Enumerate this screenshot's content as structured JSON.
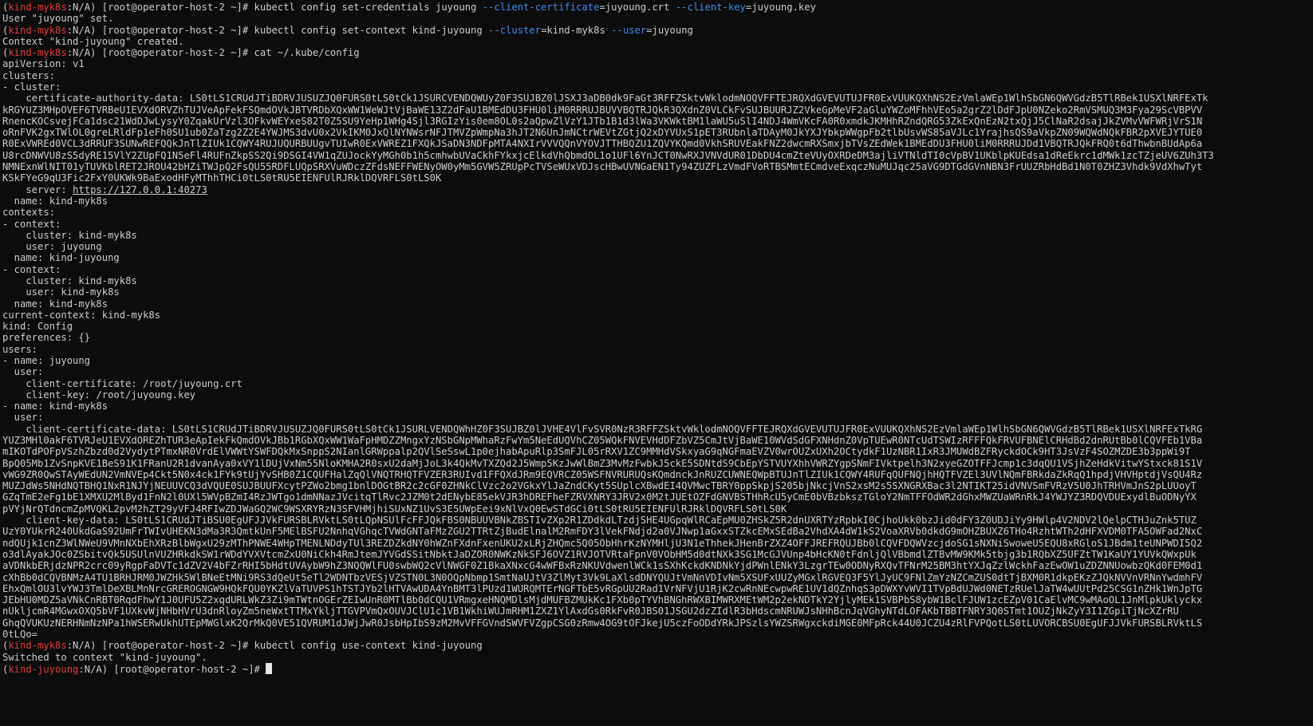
{
  "terminal": {
    "colors": {
      "background": "#0c0c0c",
      "foreground": "#cccccc",
      "prompt_context": "#e23a3a",
      "option_flag": "#3b8eea"
    },
    "lines": [
      [
        {
          "t": "("
        },
        {
          "t": "kind-myk8s",
          "c": "ctx"
        },
        {
          "t": ":N/A) [root@operator-host-2 ~]# kubectl config set-credentials juyoung "
        },
        {
          "t": "--client-certificate",
          "c": "opt"
        },
        {
          "t": "=juyoung.crt "
        },
        {
          "t": "--client-key",
          "c": "opt"
        },
        {
          "t": "=juyoung.key"
        }
      ],
      [
        {
          "t": "User \"juyoung\" set."
        }
      ],
      [
        {
          "t": "("
        },
        {
          "t": "kind-myk8s",
          "c": "ctx"
        },
        {
          "t": ":N/A) [root@operator-host-2 ~]# kubectl config set-context kind-juyoung "
        },
        {
          "t": "--cluster",
          "c": "opt"
        },
        {
          "t": "=kind-myk8s "
        },
        {
          "t": "--user",
          "c": "opt"
        },
        {
          "t": "=juyoung"
        }
      ],
      [
        {
          "t": "Context \"kind-juyoung\" created."
        }
      ],
      [
        {
          "t": "("
        },
        {
          "t": "kind-myk8s",
          "c": "ctx"
        },
        {
          "t": ":N/A) [root@operator-host-2 ~]# cat ~/.kube/config"
        }
      ],
      [
        {
          "t": "apiVersion: v1"
        }
      ],
      [
        {
          "t": "clusters:"
        }
      ],
      [
        {
          "t": "- cluster:"
        }
      ],
      [
        {
          "t": "    certificate-authority-data: LS0tLS1CRUdJTiBDRVJUSUZJQ0FURS0tLS0tCk1JSURCVENDQWUyZ0F3SUJBZ0lJSXJ3aDB0dk9FaGt3RFFZSktvWklodmNOQVFFTEJRQXdGVEVUTUJFR0ExVUUKQXhNS2EzVmlaWEp1WlhSbGN6QWVGdzB5TlRBek1USXlNRFExTk"
        }
      ],
      [
        {
          "t": "kRGYUZ3MHpOVEF6TVRBeU1EVXdORVZhTUJVeApFekFSQmdOVkJBTVRDbXQxWW1WeWJtVjBaWE13Z2dFaU1BMEdDU3FHU0liM0RRRUJBUVVBQTRJQkR3QXdnZ0VLCkFvSUJBUURJZ2VkeGpMeVF2aGluYWZoMFhhVEo5a2grZ2lDdFJpU0NZeko2RmVSMUQ3M3Fya29ScVBPVV"
        }
      ],
      [
        {
          "t": "RnencKOCsvejFCa1dsc21WdDJwLysyY0ZqakUrVzl3OFkvWEYxeS82T0Z5SU9YeHp1WHg4Sjl3RGIzYis0em8OL0s2aQpwZlVzY1JTb1B1d3lWa3VKWktBM1laWU5uSlI4NDJ4WmVKcFA0R0xmdkJKMHhRZndQRG53ZkExQnEzN2txQjJ5ClNaR2dsajJkZVMvVWFWRjVrS1N"
        }
      ],
      [
        {
          "t": "oRnFVK2gxTWlOL0greLRldFp1eFh0SU1ub0ZaTzg2Z2E4YWJMS3dvU0x2VkIKM0JxQlNYNWsrNFJTMVZpWmpNa3hJT2N6UnJmNCtrWEVtZGtjQ2xDYVUxS1pET3RUbnlaTDAyM0JkYXJYbkpWWgpFb2tlbUsvWS85aVJLc1YrajhsQS9aVkpZN09WQWdNQkFBR2pXVEJYTUE0"
        }
      ],
      [
        {
          "t": "R0ExVWREd0VCL3dRRUF3SUNwREFQQkJnTlZIUk1CQWY4RUJUQURBUUgvTUIwR0ExVWREZ1FXQkJSaDN3NDFpMTA4NXIrVVVQQnVYOVJTTHBQZU1ZQVYKQmd0VkhSRUVEakFNZ2dwcmRXSmxjbTVsZEdWek1BMEdDU3FHU0liM0RRRUJDd1VBQTRJQkFRQ0t6dThwbnBUdAp6a"
        }
      ],
      [
        {
          "t": "U8rcDNWVU8zS5dyRE15VlY2ZUpFQ1N5eFl4RUFnZkpSS2Qi9DSGI4VW1qZUJockYyMGh0b1h5cmhwbUVaCkhFYkxjcElkdVhQbmdOL1o1UFl6YnJCT0NwRXJVNVdUR01DbDU4cmZteVUyOXRDeDM3ajliVTNldTI0cVpBV1UKblpKUEdsa1dReEkrc1dMWk1zcTZjeUV6ZUh3T3"
        }
      ],
      [
        {
          "t": "NMNExnWlNIT01yTUVKblRET2JROU42bHZiTWJpQ2FsQU55RDFLUQpSRXVuWDczZFdsNEFFWENyOW0yMm5GVW5ZRUpPcTVSeWUxVDJscHBwUVNGaEN1Ty94ZUZFLzVmdFVoRTBSMmtECmdveExqczNuMUJqc25aVG9DTGdGVnNBN3FrUUZRbHdBd1N0T0ZHZ3Vhdk9VdXhwTyt"
        }
      ],
      [
        {
          "t": "KSkFYeG9qU3Fic2FxY0UKWk9BaExodHFyMThhTHCi0tLS0tRU5EIENFUlRJRklDQVRFLS0tLS0K"
        }
      ],
      [
        {
          "t": "    server: "
        },
        {
          "t": "https://127.0.0.1:40273",
          "c": "url"
        }
      ],
      [
        {
          "t": "  name: kind-myk8s"
        }
      ],
      [
        {
          "t": "contexts:"
        }
      ],
      [
        {
          "t": "- context:"
        }
      ],
      [
        {
          "t": "    cluster: kind-myk8s"
        }
      ],
      [
        {
          "t": "    user: juyoung"
        }
      ],
      [
        {
          "t": "  name: kind-juyoung"
        }
      ],
      [
        {
          "t": "- context:"
        }
      ],
      [
        {
          "t": "    cluster: kind-myk8s"
        }
      ],
      [
        {
          "t": "    user: kind-myk8s"
        }
      ],
      [
        {
          "t": "  name: kind-myk8s"
        }
      ],
      [
        {
          "t": "current-context: kind-myk8s"
        }
      ],
      [
        {
          "t": "kind: Config"
        }
      ],
      [
        {
          "t": "preferences: {}"
        }
      ],
      [
        {
          "t": "users:"
        }
      ],
      [
        {
          "t": "- name: juyoung"
        }
      ],
      [
        {
          "t": "  user:"
        }
      ],
      [
        {
          "t": "    client-certificate: /root/juyoung.crt"
        }
      ],
      [
        {
          "t": "    client-key: /root/juyoung.key"
        }
      ],
      [
        {
          "t": "- name: kind-myk8s"
        }
      ],
      [
        {
          "t": "  user:"
        }
      ],
      [
        {
          "t": "    client-certificate-data: LS0tLS1CRUdJTiBDRVJUSUZJQ0FURS0tLS0tCk1JSURLVENDQWhHZ0F3SUJBZ0lJVHE4VlFvSVR0NzR3RFFZSktvWklodmNOQVFFTEJRQXdGVEVUTUJFR0ExVUUKQXhNS2EzVmlaWEp1WlhSbGN6QWVGdzB5TlRBek1USXlNRFExTkRG"
        }
      ],
      [
        {
          "t": "YUZ3MHl0akF6TVRJeU1EVXdOREZhTUR3eApIekFkQmdOVkJBb1RGbXQxWW1WaFpHMDZZMngxYzNSbGNpMWhaRzFwYm5NeEdUQVhCZ05WQkFNVEVHdDFZbVZ5CmJtVjBaWE10WVdSdGFXNHdnZ0VpTUEwR0NTcUdTSWIzRFFFQkFRVUFBNElCRHdBd2dnRUtBb0lCQVFEb1VBa"
        }
      ],
      [
        {
          "t": "mIKOTdPOFpVSzhZbzd0d2VydytPTmxNR0VrdElVWWtYSWFDQkMxSnppS2NIanlGRWppalp2QVlSeSswL1p0ejhabApuRlp3SmFJL05rRXV1ZC9MMHdVSkxyaG9qNGFmaEVZV0wrOUZxUXh2OCtydkF1UzNBR1IxR3JMUWdBZFRyckdOCk9HT3JsVzF4SOZMZDE3b3ppWi9T"
        }
      ],
      [
        {
          "t": "BpQ05Mb1ZvSnpKVE1BeS91K1FRanU2R1dvanAya0xVY1lDUjVxNm55NloKMHA2R0sxU2daMjJoL3k4QkMvTXZQd2J5Wmp5KzJwWlBmZ3MvMzFwbkJ5ckE5SDNtdS9CbEpYSTVUYXhhVWRZYgpSNmFIVktpelh3N2xyeGZOTFFJcmp1c3dqQU1VSjhZeHdkVitwYStxck81S1V"
        }
      ],
      [
        {
          "t": "vWG9ZR0QwSTAyWEdUN2VmNVEp4Ckt5N0x4ck1FYk9tUjYvSHB0Z1CQUFHalZqQlVNQTRHQTFVZER3RUIvd1FFQXdJRm9EQVRCZ05WSFNVRURUQsKQmdnckJnRUZCUWNEQWpBTUJnTlZIUk1CQWY4RUFqQUFNQjhHQTFVZEl3UVlNQmFBRkdaZkRqQ1hpdjVHVHptdjVsQU4Rz"
        }
      ],
      [
        {
          "t": "MUZJdWs5NHdNQTBHQ1NxR1NJYjNEUUVCQ3dVQUE0SUJBUUFXcytPZWo2bmg1bnlDOGtBR2c2cGF0ZHNkClVzc2o2VGkxYlJaZndCKyt5SUplcXBwdEI4QVMwcTBRY0ppSkpjS205bjNkcjVnS2xsM2s5SXNGRXBac3l2NTIKT25idVNVSmFVRzV5U0JhTRHVmJnS2pLUUoyT"
        }
      ],
      [
        {
          "t": "GZqTmE2eFg1bE1XMXU2MlByd1FnN2l0UXl5WVpBZmI4RzJWTgo1dmNNazJVcitqTlRvc2JZM0t2dENybE85ekVJR3hDREFheFZRVXNRY3JRV2x0M2tJUEtOZFdGNVBSTHhRcU5yCmE0bVBzbkszTGloY2NmTFFOdWR2dGhxMWZUaWRnRkJ4YWJYZ3RDQVDUExydlBuODNyYX"
        }
      ],
      [
        {
          "t": "pVYjNrQTdncmZpMVQKL2pvM2hZT29yVFJ4RFIwZDJWaGQ2WC9WSXRYRzN3SFVHMjhiSUxNZ1UvS3E5UWpEei9xNlVxQ0EwSTdGCi0tLS0tRU5EIENFUlRJRklDQVRFLS0tLS0K"
        }
      ],
      [
        {
          "t": "    client-key-data: LS0tLS1CRUdJTiBSU0EgUFJJVkFURSBLRVktLS0tLQpNSUlFcFFJQkFBS0NBUUVBNkZBSTIvZXp2R1ZDdkdLTzdjSHE4UGpqWlRCaEpMU0ZHSkZ5R2dnUXRTYzRpbkI0CjhoUkk0bzJid0dFY3Z0UDJiYy9HWlp4V2NDV2lQelpCTHJuZnk5TUZ"
        }
      ],
      [
        {
          "t": "UzY0YUkrR240UkdGaS92UmFrTWIvUHEKN3dMa3R3QmtkUnF5MElBSFU2NnhqVGhqcTVWdGNTaFMzZGU2TTRtZjBudElnalM2RmFDY3lVekFNdjd2a0VJNwp1aGxxSTZkcEMxSEdBa2VhdXA4dW1kS2VoaXRVb0dkdG9mOHZBUXZ6THo4RzhtWTh2dHFXVDM0TFA5OWFad2NxC"
        }
      ],
      [
        {
          "t": "ndQUjk1cnZ3WlNWeU9VMnNXbEhXRzBlbWgxU29zMThPNWE4WHpTMENLNDdyTUl3REZDZkdNY0hWZnFXdnFxenUKU2xLRjZHQmc5Q05ObHhrKzNYMHljU3N1eThhekJHenBrZXZ4OFFJREFRQUJBb0lCQVFDQWVzcjdoSG1sNXNiSwoweU5EQU8xRGloS1JBdm1teUNPWDI5Q2"
        }
      ],
      [
        {
          "t": "o3dlAyakJOc0ZSbitvQk5USUlnVUZHRkdkSW1rWDdYVXVtcmZxU0NiCkh4RmJtemJYVGdSSitNbktJaDZOR0NWKzNkSFJ6OVZ1RVJOTVRtaFpnV0VObHM5d0dtNXk3SG1McGJVUnp4bHcKN0tFdnljQlVBbmdlZTBvMW9KMk5tbjg3b1RQbXZ5UFZtTW1KaUY1YUVkQWxpUk"
        }
      ],
      [
        {
          "t": "aVDNkbERjdzNPR2crc09yRgpFaDVTc1dZV2V4bFZrRHI5bHdtUVAybW9hZ3NQQWlFU0swbWQ2cVlNWGF0Z1BkaXNxcG4wWFBxRzNKUVdwenlWCk1sSXhKckdKNDNkYjdPWnlENkY3LzgrTEw0ODNyRXQvTFNrM25BM3htYXJqZzlWckhFazEwOW1uZDZNNUowbzQKd0FEM0d1"
        }
      ],
      [
        {
          "t": "cXhBb0dCQVBNMzA4TU1BRHJRM0JWZHk5WlBNeEtMNi9RS3dQeUt5eTl2WDNTbzVESjVZSTN0L3N0OQpNbmp1SmtNaUJtV3ZlMyt3Vk9LaXlsdDNYQUJtVmNnVDIvNm5XSUFxUUZyMGxlRGVEQ3F5YlJyUC9FNlZmYzNZCmZUS0dtTjBXM0R1dkpEKzZJQkNVVnVRNnYwdmhFV"
        }
      ],
      [
        {
          "t": "EhxQmlOU3lvYWJ3TmlDeXBLMnNrcGREROGNGW9HQkFQU0YKZlVaTUVPS1hTSTJYb2lHTVAwUDA4YnBMT3lPUzd1WURQMTErNGFTbE5vRGpUU2Rad1VrNFVjU1RjK2cwRnNEcwpwRE1UV1dQZnhqS3pDWXYvWVI1TVpBdUJWd0NETzRUelJaTW4wUUtPd25CSG1nZHk1WnJpTG"
        }
      ],
      [
        {
          "t": "JEbHU0MDZ5aVNkCnRBT0RqdFhwY1J0UFU5Z2xqdURLWkZ3Zi9mTWtnOGErZEIwUnR0MTlBb0dCQU1VRmgxeHNQMDlsMjdMUFBZMUkKc1FXb0pTYVhBNGhRWXBIMWRXMEtWM2p2ekNDTkY2YjlyMEk1SVBPbS8ybW1BclFJUW1zcEZpV01CaElvMC9wMAoOL1JnMlpkUklyckx"
        }
      ],
      [
        {
          "t": "nUkljcmR4MGwxOXQ5bVF1UXkvWjNHbHVrU3dnRloyZm5neWxtTTMxYkljTTGVPVmQxOUVJClU1c1VB1WkhiWUJmRHM1ZXZ1YlAxdGs0RkFvR0JBS01JSGU2dzZIdlR3bHdscmNRUWJsNHhBcnJqVGhyNTdLOFAKbTBBTFNRY3Q0STmt1OUZjNkZyY3I1ZGpiTjNcXZrRU"
        }
      ],
      [
        {
          "t": "GhqQVUKUzNERHNmNzNPa1hWSERwUkhUTEpMWGlxK2QrMkQ0VE51QVRUM1dJWjJwR0JsbHpIbS9zM2MvVFFGVndSWVFVZgpCSG0zRmw4OG9tOFJkejU5czFoODdYRkJPSzlsYWZSRWgxckdiMGE0MFpRck44U0JCZU4zRlFVPQotLS0tLUVORCBSU0EgUFJJVkFURSBLRVktLS"
        }
      ],
      [
        {
          "t": "0tLQo="
        }
      ],
      [
        {
          "t": "("
        },
        {
          "t": "kind-myk8s",
          "c": "ctx"
        },
        {
          "t": ":N/A) [root@operator-host-2 ~]# kubectl config use-context kind-juyoung"
        }
      ],
      [
        {
          "t": "Switched to context \"kind-juyoung\"."
        }
      ],
      [
        {
          "t": "("
        },
        {
          "t": "kind-juyoung",
          "c": "ctx"
        },
        {
          "t": ":N/A) [root@operator-host-2 ~]# "
        },
        {
          "t": "",
          "c": "cursor"
        }
      ]
    ]
  }
}
